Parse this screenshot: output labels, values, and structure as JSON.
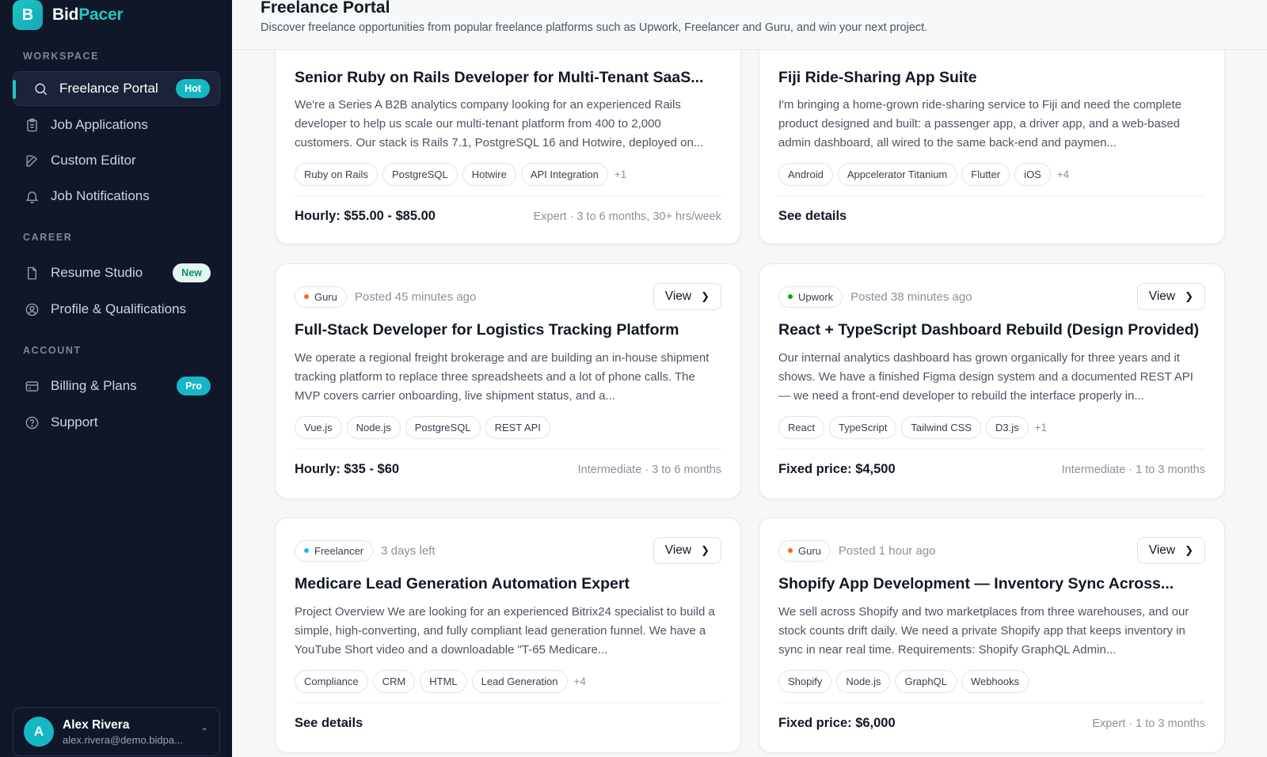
{
  "brand": {
    "logo_letter": "B",
    "name_part1": "Bid",
    "name_part2": "Pacer"
  },
  "sidebar": {
    "sections": {
      "workspace": "WORKSPACE",
      "career": "CAREER",
      "account": "ACCOUNT"
    },
    "items": [
      {
        "label": "Freelance Portal",
        "icon": "search-icon",
        "badge": "Hot"
      },
      {
        "label": "Job Applications",
        "icon": "clipboard-icon"
      },
      {
        "label": "Custom Editor",
        "icon": "edit-icon"
      },
      {
        "label": "Job Notifications",
        "icon": "bell-icon"
      },
      {
        "label": "Resume Studio",
        "icon": "file-icon",
        "badge": "New"
      },
      {
        "label": "Profile & Qualifications",
        "icon": "user-circle-icon"
      },
      {
        "label": "Billing & Plans",
        "icon": "credit-card-icon",
        "badge": "Pro"
      },
      {
        "label": "Support",
        "icon": "help-circle-icon"
      }
    ]
  },
  "user": {
    "initial": "A",
    "name": "Alex Rivera",
    "email": "alex.rivera@demo.bidpa..."
  },
  "header": {
    "title": "Freelance Portal",
    "subtitle": "Discover freelance opportunities from popular freelance platforms such as Upwork, Freelancer and Guru, and win your next project."
  },
  "cards": [
    {
      "title": "Senior Ruby on Rails Developer for Multi-Tenant SaaS...",
      "description": "We're a Series A B2B analytics company looking for an experienced Rails developer to help us scale our multi-tenant platform from 400 to 2,000 customers. Our stack is Rails 7.1, PostgreSQL 16 and Hotwire, deployed on...",
      "tags": [
        "Ruby on Rails",
        "PostgreSQL",
        "Hotwire",
        "API Integration"
      ],
      "more": "+1",
      "price": "Hourly: $55.00 - $85.00",
      "meta": "Expert · 3 to 6 months, 30+ hrs/week"
    },
    {
      "title": "Fiji Ride-Sharing App Suite",
      "description": "I'm bringing a home-grown ride-sharing service to Fiji and need the complete product designed and built: a passenger app, a driver app, and a web-based admin dashboard, all wired to the same back-end and paymen...",
      "tags": [
        "Android",
        "Appcelerator Titanium",
        "Flutter",
        "iOS"
      ],
      "more": "+4",
      "see_details": "See details"
    },
    {
      "platform": "Guru",
      "platform_color": "#f26b1d",
      "posted": "Posted 45 minutes ago",
      "view": "View",
      "title": "Full-Stack Developer for Logistics Tracking Platform",
      "description": "We operate a regional freight brokerage and are building an in-house shipment tracking platform to replace three spreadsheets and a lot of phone calls. The MVP covers carrier onboarding, live shipment status, and a...",
      "tags": [
        "Vue.js",
        "Node.js",
        "PostgreSQL",
        "REST API"
      ],
      "price": "Hourly: $35 - $60",
      "meta": "Intermediate · 3 to 6 months"
    },
    {
      "platform": "Upwork",
      "platform_color": "#14a800",
      "posted": "Posted 38 minutes ago",
      "view": "View",
      "title": "React + TypeScript Dashboard Rebuild (Design Provided)",
      "description": "Our internal analytics dashboard has grown organically for three years and it shows. We have a finished Figma design system and a documented REST API — we need a front-end developer to rebuild the interface properly in...",
      "tags": [
        "React",
        "TypeScript",
        "Tailwind CSS",
        "D3.js"
      ],
      "more": "+1",
      "price": "Fixed price: $4,500",
      "meta": "Intermediate · 1 to 3 months"
    },
    {
      "platform": "Freelancer",
      "platform_color": "#29b2fe",
      "posted": "3 days left",
      "view": "View",
      "title": "Medicare Lead Generation Automation Expert",
      "description": "Project Overview We are looking for an experienced Bitrix24 specialist to build a simple, high-converting, and fully compliant lead generation funnel. We have a YouTube Short video and a downloadable \"T-65 Medicare...",
      "tags": [
        "Compliance",
        "CRM",
        "HTML",
        "Lead Generation"
      ],
      "more": "+4",
      "see_details": "See details"
    },
    {
      "platform": "Guru",
      "platform_color": "#f26b1d",
      "posted": "Posted 1 hour ago",
      "view": "View",
      "title": "Shopify App Development — Inventory Sync Across...",
      "description": "We sell across Shopify and two marketplaces from three warehouses, and our stock counts drift daily. We need a private Shopify app that keeps inventory in sync in near real time. Requirements: Shopify GraphQL Admin...",
      "tags": [
        "Shopify",
        "Node.js",
        "GraphQL",
        "Webhooks"
      ],
      "price": "Fixed price: $6,000",
      "meta": "Expert · 1 to 3 months"
    }
  ]
}
